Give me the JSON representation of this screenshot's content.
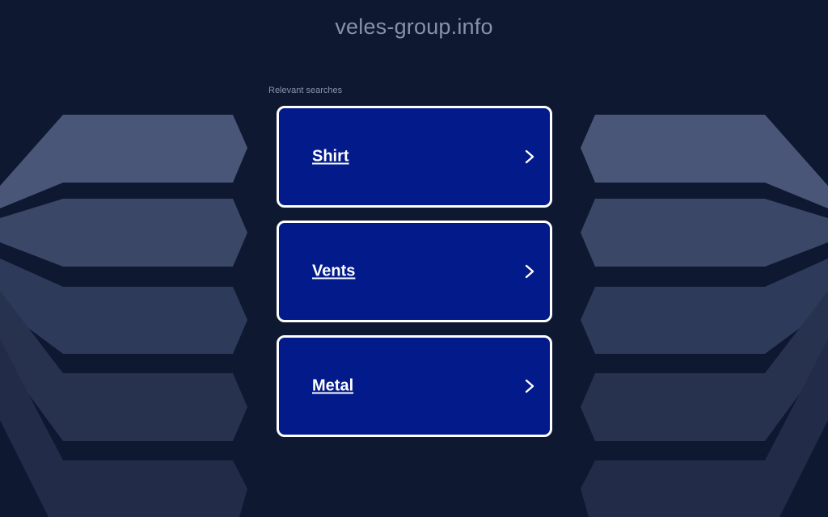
{
  "header": {
    "domain": "veles-group.info"
  },
  "search": {
    "relevant_label": "Relevant searches",
    "results": [
      {
        "label": "Shirt",
        "icon": "chevron-right-icon"
      },
      {
        "label": "Vents",
        "icon": "chevron-right-icon"
      },
      {
        "label": "Metal",
        "icon": "chevron-right-icon"
      }
    ]
  },
  "theme": {
    "background": "#0e1831",
    "card_background": "#031a8a",
    "card_border": "#ffffff",
    "title_color": "#8791a8"
  }
}
